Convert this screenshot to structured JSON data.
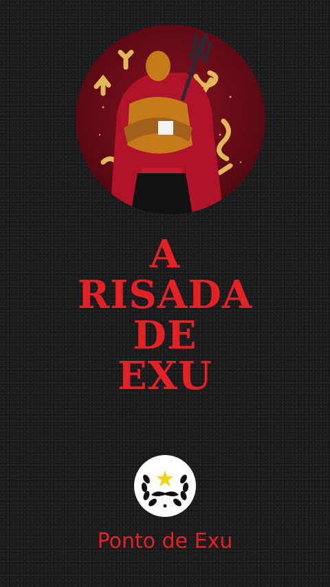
{
  "title_lines": [
    "A",
    "RISADA",
    "DE",
    "EXU"
  ],
  "footer_text": "Ponto de Exu",
  "avatar_icon": "exu-figure-trident-icon",
  "logo_icon": "laurel-star-mustache-icon",
  "colors": {
    "accent_red": "#e42125",
    "background": "#1c1c1e",
    "gold": "#e2b85c"
  }
}
